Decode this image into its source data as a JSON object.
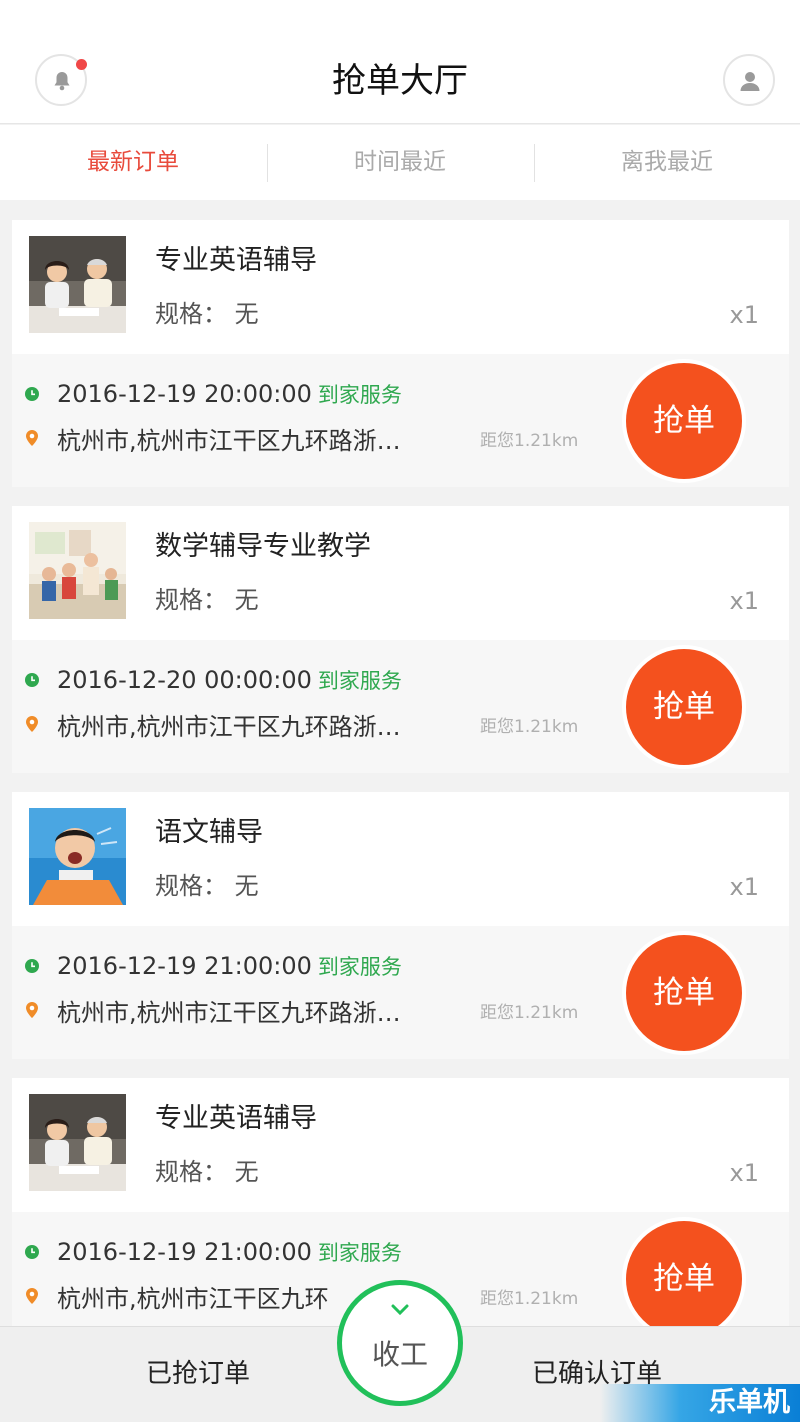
{
  "header": {
    "title": "抢单大厅"
  },
  "tabs": [
    {
      "label": "最新订单",
      "active": true
    },
    {
      "label": "时间最近",
      "active": false
    },
    {
      "label": "离我最近",
      "active": false
    }
  ],
  "colors": {
    "accent": "#e84b3c",
    "grab_button": "#f4511e",
    "service_green": "#2fa84f",
    "center_ring": "#21c05a"
  },
  "orders": [
    {
      "name": "专业英语辅导",
      "spec": "规格：  无",
      "qty": "x1",
      "datetime": "2016-12-19 20:00:00",
      "service": "到家服务",
      "address": "杭州市,杭州市江干区九环路浙…",
      "distance": "距您1.21km",
      "action": "抢单"
    },
    {
      "name": "数学辅导专业教学",
      "spec": "规格：  无",
      "qty": "x1",
      "datetime": "2016-12-20 00:00:00",
      "service": "到家服务",
      "address": "杭州市,杭州市江干区九环路浙…",
      "distance": "距您1.21km",
      "action": "抢单"
    },
    {
      "name": "语文辅导",
      "spec": "规格：  无",
      "qty": "x1",
      "datetime": "2016-12-19 21:00:00",
      "service": "到家服务",
      "address": "杭州市,杭州市江干区九环路浙…",
      "distance": "距您1.21km",
      "action": "抢单"
    },
    {
      "name": "专业英语辅导",
      "spec": "规格：  无",
      "qty": "x1",
      "datetime": "2016-12-19 21:00:00",
      "service": "到家服务",
      "address": "杭州市,杭州市江干区九环",
      "distance": "距您1.21km",
      "action": "抢单"
    }
  ],
  "bottom_nav": {
    "left": "已抢订单",
    "center": "收工",
    "right": "已确认订单"
  },
  "watermark": "乐单机"
}
